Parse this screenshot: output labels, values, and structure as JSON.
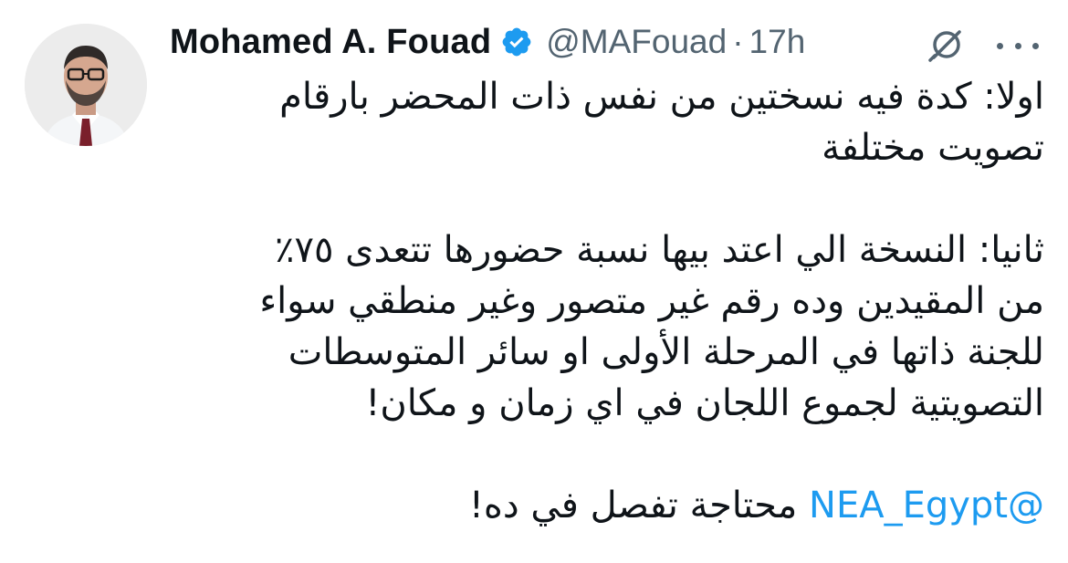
{
  "tweet": {
    "display_name": "Mohamed A. Fouad",
    "handle": "@MAFouad",
    "separator": "·",
    "time": "17h",
    "verified_color": "#1d9bf0",
    "lines": [
      "اولا: كدة فيه نسختين من  نفس ذات المحضر بارقام",
      "تصويت مختلفة",
      "",
      "ثانيا: النسخة الي اعتد بيها نسبة حضورها تتعدى ٧٥٪",
      "من المقيدين وده رقم غير متصور وغير منطقي سواء",
      "للجنة ذاتها في المرحلة الأولى او سائر المتوسطات",
      "التصويتية لجموع اللجان في اي زمان و مكان!",
      ""
    ],
    "last_line": {
      "mention": "@NEA_Egypt",
      "text": " محتاجة تفصل في ده!"
    },
    "icons": {
      "avatar": "profile-photo",
      "verified": "verified-badge-icon",
      "grok": "grok-icon",
      "more": "more-options-icon"
    }
  }
}
